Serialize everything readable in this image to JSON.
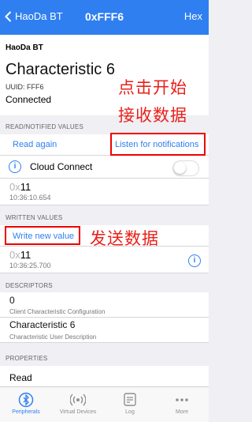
{
  "nav": {
    "back_label": "HaoDa BT",
    "title": "0xFFF6",
    "right_label": "Hex"
  },
  "header": {
    "device_name": "HaoDa BT",
    "characteristic_name": "Characteristic 6",
    "uuid": "UUID: FFF6",
    "status": "Connected"
  },
  "read_section": {
    "title": "READ/NOTIFIED VALUES",
    "read_again": "Read again",
    "listen": "Listen for notifications",
    "cloud_connect": "Cloud Connect",
    "cloud_connect_on": false,
    "value_prefix": "0x",
    "value": "11",
    "time": "10:36:10.654"
  },
  "written_section": {
    "title": "WRITTEN VALUES",
    "write_new": "Write new value",
    "value_prefix": "0x",
    "value": "11",
    "time": "10:36:25.700"
  },
  "descriptors": {
    "title": "DESCRIPTORS",
    "items": [
      {
        "value": "0",
        "label": "Client Characteristic Configuration"
      },
      {
        "value": "Characteristic 6",
        "label": "Characteristic User Description"
      }
    ]
  },
  "properties": {
    "title": "PROPERTIES",
    "items": [
      "Read"
    ]
  },
  "annotations": {
    "listen_note_line1": "点击开始",
    "listen_note_line2": "接收数据",
    "write_note": "发送数据"
  },
  "tabs": [
    {
      "label": "Peripherals",
      "icon": "peripherals-icon",
      "active": true
    },
    {
      "label": "Virtual Devices",
      "icon": "virtual-devices-icon",
      "active": false
    },
    {
      "label": "Log",
      "icon": "log-icon",
      "active": false
    },
    {
      "label": "More",
      "icon": "more-icon",
      "active": false
    }
  ],
  "colors": {
    "accent": "#2f7ff0",
    "annotation": "#e8201a",
    "background": "#efeff4"
  }
}
